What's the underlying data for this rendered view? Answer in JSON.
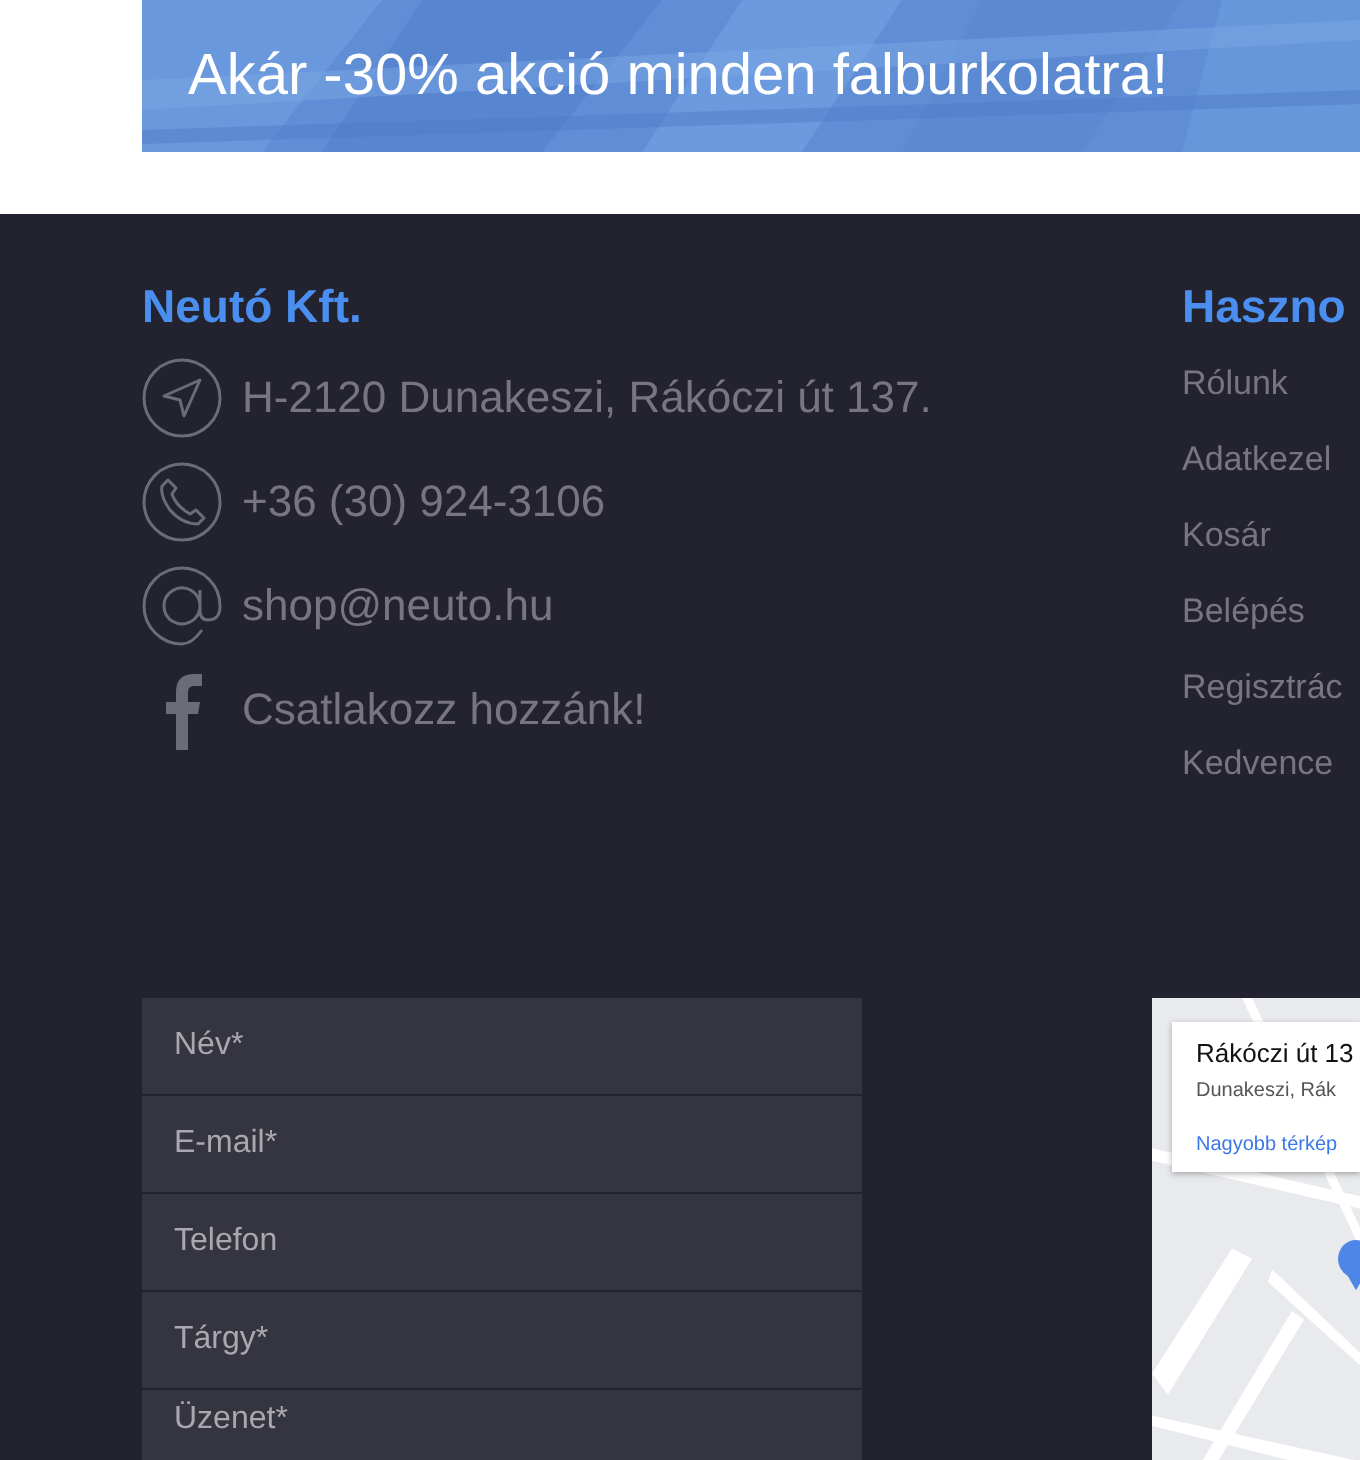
{
  "banner": {
    "text": "Akár -30% akció minden falburkolatra!"
  },
  "company": {
    "title": "Neutó Kft.",
    "contacts": [
      {
        "kind": "address",
        "text": "H-2120 Dunakeszi, Rákóczi út 137."
      },
      {
        "kind": "phone",
        "text": "+36 (30) 924-3106"
      },
      {
        "kind": "email",
        "text": "shop@neuto.hu"
      },
      {
        "kind": "facebook",
        "text": "Csatlakozz hozzánk!"
      }
    ]
  },
  "links": {
    "title": "Haszno",
    "items": [
      "Rólunk",
      "Adatkezel",
      "Kosár",
      "Belépés",
      "Regisztrác",
      "Kedvence"
    ]
  },
  "form": {
    "fields": [
      {
        "kind": "input",
        "placeholder": "Név*"
      },
      {
        "kind": "input",
        "placeholder": "E-mail*"
      },
      {
        "kind": "input",
        "placeholder": "Telefon"
      },
      {
        "kind": "input",
        "placeholder": "Tárgy*"
      },
      {
        "kind": "textarea",
        "placeholder": "Üzenet*"
      }
    ]
  },
  "map": {
    "card": {
      "title": "Rákóczi út 13",
      "address": "Dunakeszi, Rák",
      "link": "Nagyobb térkép"
    }
  }
}
